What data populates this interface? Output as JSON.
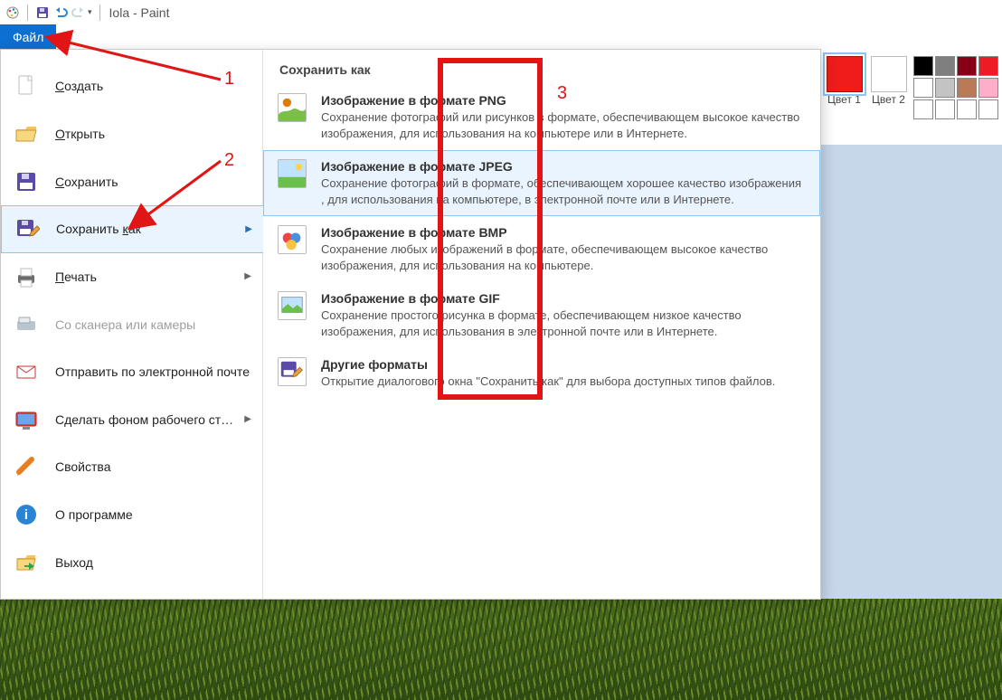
{
  "window": {
    "title": "Iola - Paint"
  },
  "qat": {
    "tips": {
      "save": "Save",
      "undo": "Undo",
      "redo": "Redo"
    }
  },
  "file_tab": "Файл",
  "file_menu": {
    "panel_title": "Сохранить как",
    "left": [
      {
        "key": "new",
        "label": "Создать",
        "ul": "С"
      },
      {
        "key": "open",
        "label": "Открыть",
        "ul": "О"
      },
      {
        "key": "save",
        "label": "Сохранить",
        "ul": "С"
      },
      {
        "key": "save_as",
        "label": "Сохранить как",
        "ul": "к",
        "sub": true,
        "selected": true
      },
      {
        "key": "print",
        "label": "Печать",
        "ul": "П",
        "sub": true
      },
      {
        "key": "scanner",
        "label": "Со сканера или камеры",
        "disabled": true
      },
      {
        "key": "send_mail",
        "label": "Отправить по электронной почте"
      },
      {
        "key": "wallpaper",
        "label": "Сделать фоном рабочего стола",
        "sub": true
      },
      {
        "key": "properties",
        "label": "Свойства"
      },
      {
        "key": "about",
        "label": "О программе"
      },
      {
        "key": "exit",
        "label": "Выход"
      }
    ],
    "formats": [
      {
        "key": "png",
        "title": "Изображение в формате PNG",
        "desc": "Сохранение фотографий или рисунков в формате, обеспечивающем высокое качество изображения, для использования на компьютере или в Интернете."
      },
      {
        "key": "jpeg",
        "title": "Изображение в формате JPEG",
        "hover": true,
        "desc": "Сохранение фотографий в формате, обеспечивающем хорошее качество изображения , для использования на компьютере, в электронной почте или в Интернете."
      },
      {
        "key": "bmp",
        "title": "Изображение в формате BMP",
        "desc": "Сохранение любых изображений в формате, обеспечивающем высокое качество изображения, для использования на компьютере."
      },
      {
        "key": "gif",
        "title": "Изображение в формате GIF",
        "desc": "Сохранение простого рисунка в формате, обеспечивающем низкое качество изображения, для использования в электронной почте или в Интернете."
      },
      {
        "key": "other",
        "title": "Другие форматы",
        "desc": "Открытие диалогового окна \"Сохранить как\" для выбора доступных типов файлов."
      }
    ]
  },
  "colors": {
    "c1_label": "Цвет 1",
    "c2_label": "Цвет 2",
    "palette": [
      "#000000",
      "#7f7f7f",
      "#880015",
      "#ed1c24",
      "#ffffff",
      "#c3c3c3",
      "#b97a57",
      "#ffaec9",
      "#ffffff",
      "#ffffff",
      "#ffffff",
      "#ffffff"
    ]
  },
  "annotations": {
    "n1": "1",
    "n2": "2",
    "n3": "3"
  }
}
